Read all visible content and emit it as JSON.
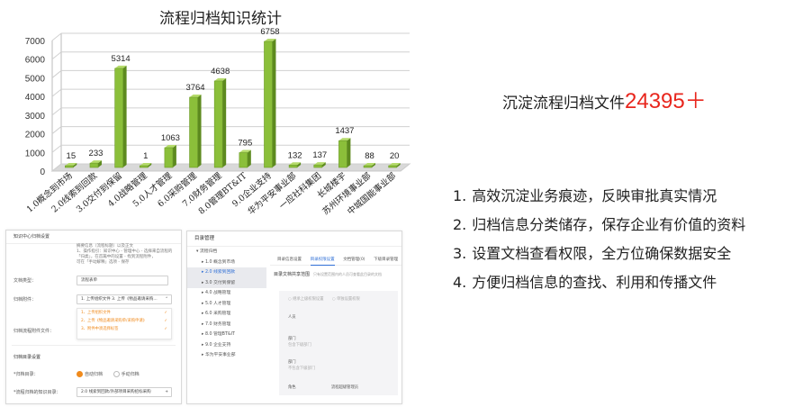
{
  "chart_data": {
    "type": "bar",
    "title": "流程归档知识统计",
    "categories": [
      "1.0概念到市场",
      "2.0线索到回款",
      "3.0交付到保留",
      "4.0战略管理",
      "5.0人才管理",
      "6.0采购管理",
      "7.0财务管理",
      "8.0管理BT&IT",
      "9.0企业支持",
      "华为平安事业部",
      "一应社科集团",
      "长城楼宇",
      "苏州环境事业部",
      "中城国能事业部"
    ],
    "values": [
      15,
      233,
      5314,
      1,
      1063,
      3764,
      4638,
      795,
      6758,
      132,
      137,
      1437,
      88,
      20
    ],
    "yticks": [
      "0",
      "1000",
      "2000",
      "3000",
      "4000",
      "5000",
      "6000",
      "7000"
    ],
    "ylim": [
      0,
      7000
    ],
    "bar_color": "#8bbf3a",
    "grid": true
  },
  "headline": {
    "prefix": "沉淀流程归档文件",
    "count": "24395＋",
    "count_color": "#e8261d"
  },
  "benefits": [
    {
      "index": "1.",
      "text": "高效沉淀业务痕迹，反映审批真实情况"
    },
    {
      "index": "2.",
      "text": "归档信息分类储存，保存企业有价值的资料"
    },
    {
      "index": "3.",
      "text": "设置文档查看权限，全方位确保数据安全"
    },
    {
      "index": "4.",
      "text": "方便归档信息的查找、利用和传播文件"
    }
  ],
  "screenshot1": {
    "title": "知识中心归档设置",
    "desc": [
      "摘要信息（流程标题）以及正文",
      "1、操作指引：知识中心 - 管理中心 - 选择来自流程的",
      "「归类」，在首篇中的设置 - 找到流程附件，",
      "可在「手动解释」选项 - 保存"
    ],
    "doc_type_label": "文档类型：",
    "doc_type_value": "流程表单",
    "attach_label": "归档附件：",
    "attach_value": "1. 上传组织文件 3. 上传《物品邀请采购...",
    "options": [
      "1、上传组织文件",
      "2、上传《物品邀请采购单/采购申请》",
      "3、附件中须选择标签"
    ],
    "field_label": "归档流程附件文件：",
    "section_title": "归档目录设置",
    "mode_label": "*归档目录：",
    "mode_auto": "自动归档",
    "mode_manual": "手动归档",
    "dir_label": "*流程归档的知识目录：",
    "dir_value": "2.0 线索到回款/外部项目采购招标采购"
  },
  "screenshot2": {
    "title": "目录管理",
    "tree": [
      "流程归档",
      "1.0 概念到市场",
      "2.0 线索到回款",
      "3.0 交付到保留",
      "4.0 战略管理",
      "5.0 人才管理",
      "6.0 采购管理",
      "7.0 财务管理",
      "8.0 管理BT&IT",
      "9.0 企业支持",
      "华为平安事业部"
    ],
    "tabs": [
      "目录信息设置",
      "目录权限设置",
      "文档管理(0)",
      "下级目录管理"
    ],
    "pane_title": "目录文档共享范围",
    "pane_hint": "只有设置范围内的人员可查看此目录的文档",
    "opt1": "继承上级权限设置",
    "opt2": "单独设置权限",
    "person_label": "人员",
    "dept_label": "部门",
    "dept_ph": "包含下级部门",
    "dept2_label": "部门",
    "dept2_ph": "不包含下级部门",
    "role_label": "角色",
    "role_value": "流程超级管理员"
  }
}
